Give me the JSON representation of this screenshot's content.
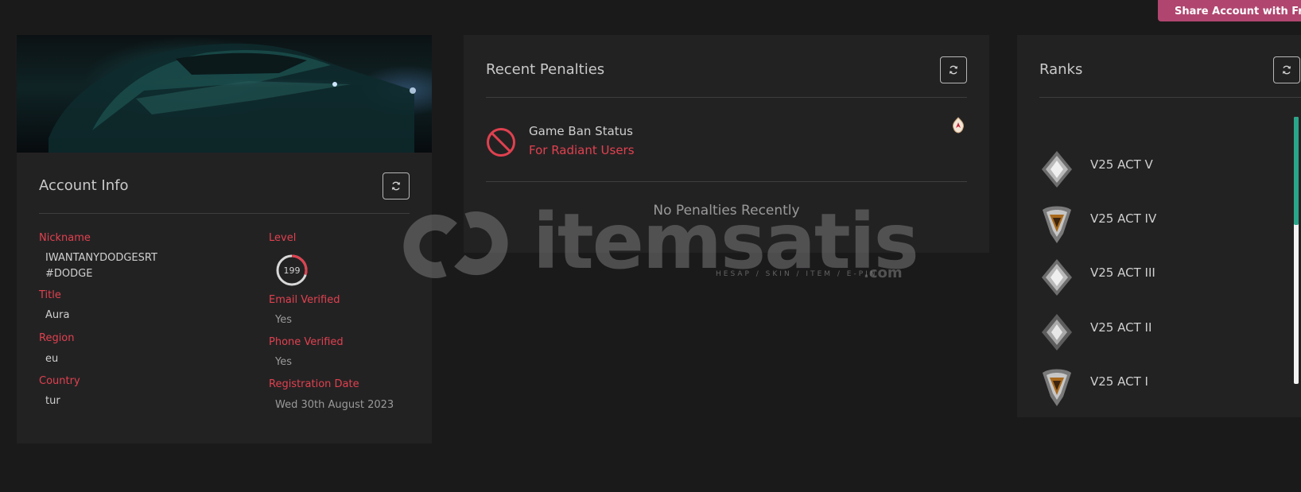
{
  "header": {
    "share_label": "Share Account with Friends"
  },
  "account": {
    "title": "Account Info",
    "refresh_icon": "refresh-icon",
    "nickname_label": "Nickname",
    "nickname_line1": "IWANTANYDODGESRT",
    "nickname_line2": "#DODGE",
    "title_label": "Title",
    "title_value": "Aura",
    "region_label": "Region",
    "region_value": "eu",
    "country_label": "Country",
    "country_value": "tur",
    "level_label": "Level",
    "level_value": "199",
    "level_progress": 0.3,
    "email_label": "Email Verified",
    "email_value": "Yes",
    "phone_label": "Phone Verified",
    "phone_value": "Yes",
    "registration_label": "Registration Date",
    "registration_value": "Wed 30th August 2023"
  },
  "penalties": {
    "title": "Recent Penalties",
    "ban_title": "Game Ban Status",
    "ban_subtitle": "For Radiant Users",
    "empty_text": "No Penalties Recently"
  },
  "ranks": {
    "title": "Ranks",
    "items": [
      {
        "label": "V25 ACT V",
        "icon": "silver-rank-icon"
      },
      {
        "label": "V25 ACT IV",
        "icon": "gold-rank-icon"
      },
      {
        "label": "V25 ACT III",
        "icon": "silver-rank-icon"
      },
      {
        "label": "V25 ACT II",
        "icon": "silver-rank-icon"
      },
      {
        "label": "V25 ACT I",
        "icon": "gold-rank-icon"
      }
    ]
  },
  "watermark": {
    "brand": "itemsatis",
    "tagline": "HESAP / SKIN / ITEM / E-PIN",
    "suffix": ".com"
  },
  "colors": {
    "background": "#1b1a1b",
    "card": "#232223",
    "accent_red": "#e0414f",
    "share_button": "#b0466f",
    "scroll_thumb": "#2aa58a"
  }
}
